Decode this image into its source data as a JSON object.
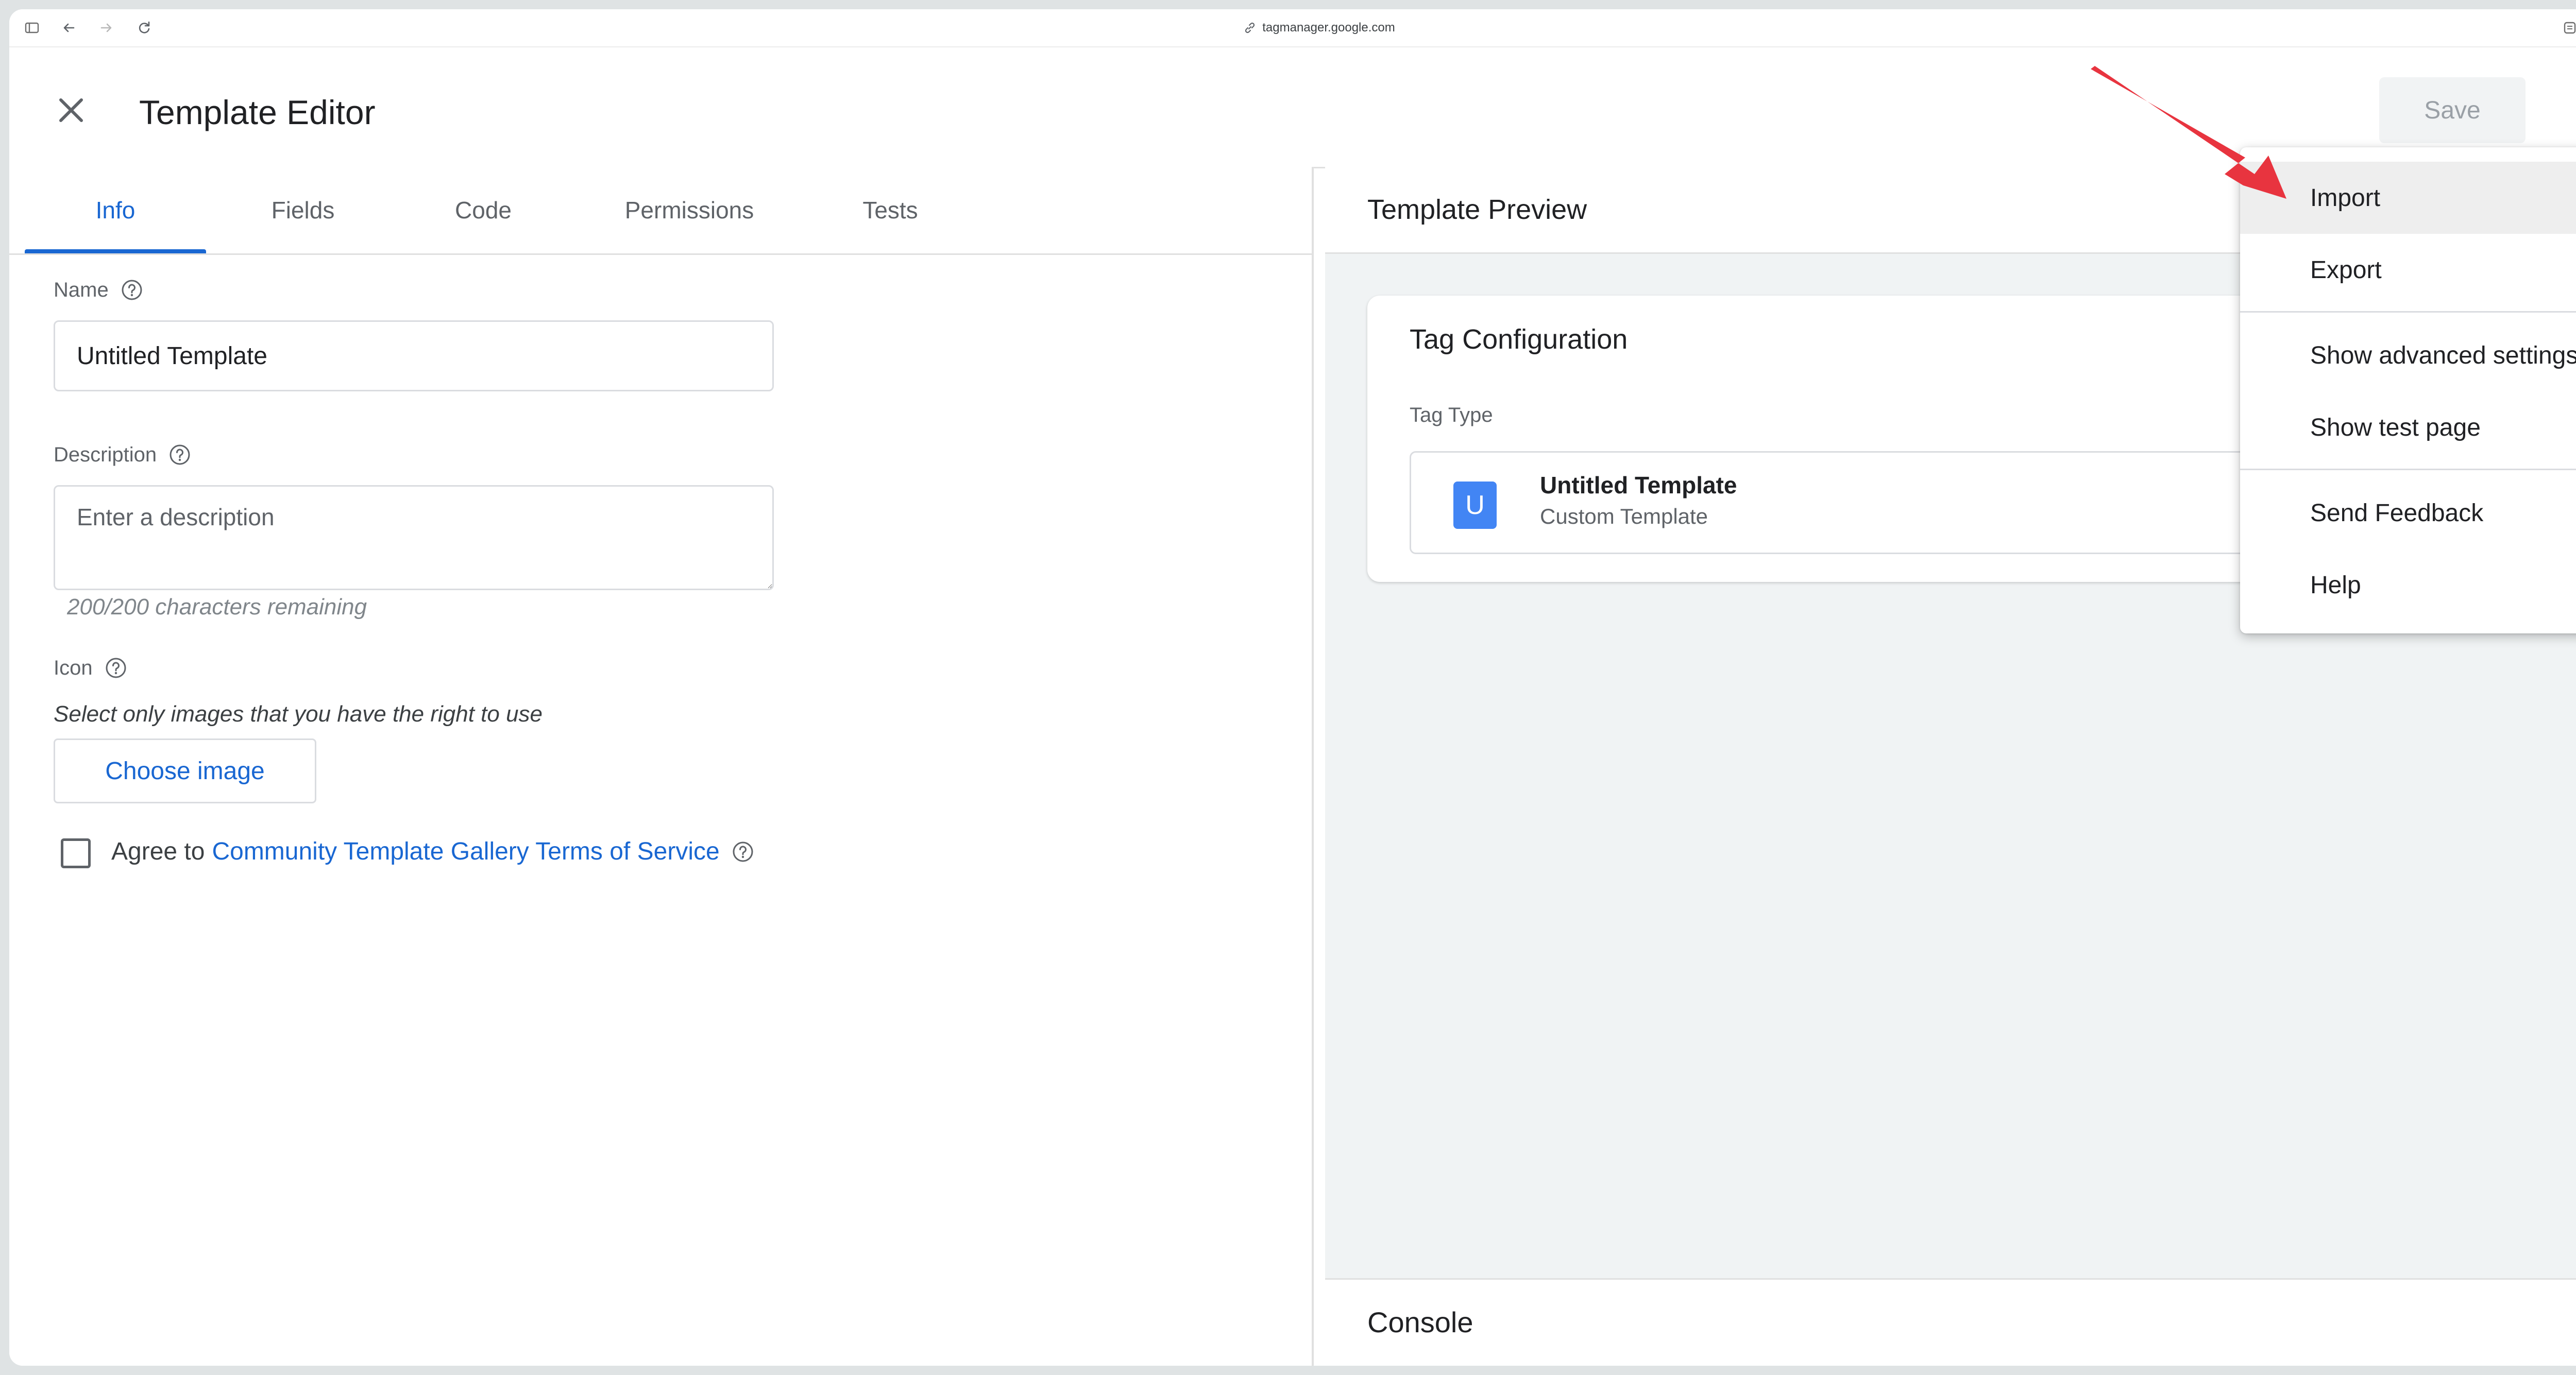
{
  "browser": {
    "url": "tagmanager.google.com"
  },
  "header": {
    "title": "Template Editor",
    "save_label": "Save"
  },
  "tabs": [
    {
      "label": "Info",
      "active": true
    },
    {
      "label": "Fields"
    },
    {
      "label": "Code"
    },
    {
      "label": "Permissions"
    },
    {
      "label": "Tests"
    }
  ],
  "form": {
    "name_label": "Name",
    "name_value": "Untitled Template",
    "description_label": "Description",
    "description_placeholder": "Enter a description",
    "description_counter": "200/200 characters remaining",
    "icon_label": "Icon",
    "icon_hint": "Select only images that you have the right to use",
    "choose_image_label": "Choose image",
    "agree_prefix": "Agree to",
    "agree_link": "Community Template Gallery Terms of Service",
    "agree_checked": false
  },
  "preview": {
    "title": "Template Preview",
    "card_title": "Tag Configuration",
    "tag_type_label": "Tag Type",
    "template_badge": "U",
    "template_name": "Untitled Template",
    "template_sub": "Custom Template",
    "console_label": "Console"
  },
  "menu": {
    "items": [
      {
        "label": "Import",
        "highlighted": true
      },
      {
        "label": "Export"
      },
      {
        "label": "Show advanced settings"
      },
      {
        "label": "Show test page"
      },
      {
        "label": "Send Feedback"
      },
      {
        "label": "Help"
      }
    ]
  },
  "colors": {
    "accent": "#1967d2",
    "badge": "#4285f4",
    "annotation_arrow": "#e8343f",
    "panel_bg": "#f0f3f4"
  }
}
